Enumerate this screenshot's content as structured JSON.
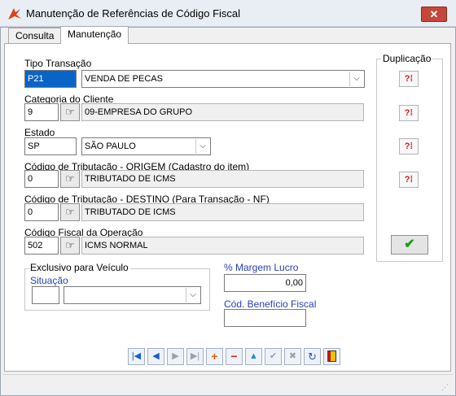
{
  "window": {
    "title": "Manutenção de Referências de Código Fiscal",
    "close_icon": "close-icon"
  },
  "tabs": [
    {
      "label": "Consulta"
    },
    {
      "label": "Manutenção"
    }
  ],
  "form": {
    "tipo_transacao": {
      "label": "Tipo Transação",
      "code": "P21",
      "description": "VENDA DE PECAS"
    },
    "categoria_cliente": {
      "label": "Categoria do Cliente",
      "code": "9",
      "description": "09-EMPRESA DO GRUPO"
    },
    "estado": {
      "label": "Estado",
      "code": "SP",
      "description": "SÃO PAULO"
    },
    "trib_origem": {
      "label": "Código de Tributação - ORIGEM (Cadastro do item)",
      "code": "0",
      "description": "TRIBUTADO DE ICMS"
    },
    "trib_destino": {
      "label": "Código de Tributação - DESTINO (Para Transação - NF)",
      "code": "0",
      "description": "TRIBUTADO DE ICMS"
    },
    "cfop": {
      "label": "Código Fiscal da Operação",
      "code": "502",
      "description": "ICMS NORMAL"
    }
  },
  "duplicacao": {
    "label": "Duplicação"
  },
  "veiculo": {
    "group_label": "Exclusivo para Veículo",
    "situacao_label": "Situação",
    "situacao_code": "",
    "situacao_value": ""
  },
  "margem": {
    "label": "% Margem Lucro",
    "value": "0,00"
  },
  "beneficio": {
    "label": "Cód. Benefício Fiscal",
    "value": ""
  },
  "colors": {
    "accent_blue": "#2840b8",
    "confirm_green": "#1e9a1e",
    "close_red": "#c7463a"
  }
}
